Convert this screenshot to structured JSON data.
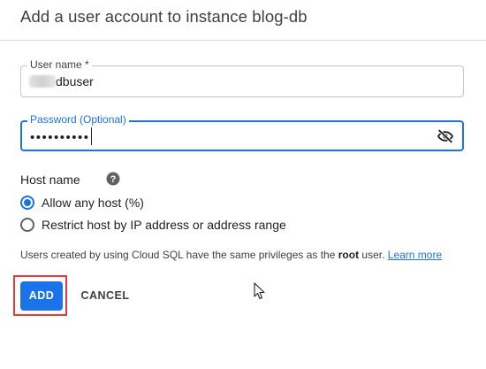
{
  "dialog": {
    "title": "Add a user account to instance blog-db"
  },
  "username_field": {
    "label": "User name *",
    "value": "dbuser"
  },
  "password_field": {
    "label": "Password (Optional)",
    "masked_value": "••••••••••",
    "toggle_icon": "eye-off-icon"
  },
  "host": {
    "label": "Host name",
    "help_icon": "help-icon",
    "options": [
      {
        "label": "Allow any host (%)",
        "checked": true
      },
      {
        "label": "Restrict host by IP address or address range",
        "checked": false
      }
    ]
  },
  "info": {
    "text_before": "Users created by using Cloud SQL have the same privileges as the ",
    "bold": "root",
    "text_after": " user. ",
    "link": "Learn more"
  },
  "actions": {
    "add_label": "ADD",
    "cancel_label": "CANCEL"
  },
  "colors": {
    "primary": "#1a73e8",
    "highlight": "#e5393b",
    "text": "#202124"
  }
}
